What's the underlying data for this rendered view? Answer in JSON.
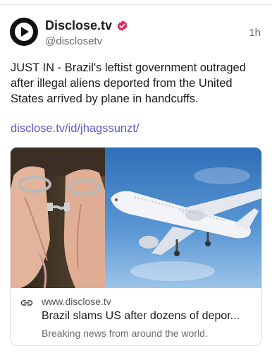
{
  "post": {
    "author_name": "Disclose.tv",
    "author_handle": "@disclosetv",
    "timestamp": "1h",
    "text": "JUST IN - Brazil's leftist government outraged after illegal aliens deported from the United States arrived by plane in handcuffs.",
    "link": "disclose.tv/id/jhagssunzt/",
    "avatar_icon": "play-logo-icon",
    "verified_icon": "verified-badge-icon",
    "verified_color": "#e0245e"
  },
  "card": {
    "domain": "www.disclose.tv",
    "title": "Brazil slams US after dozens of depor...",
    "description": "Breaking news from around the world.",
    "link_icon": "chain-link-icon",
    "image_left": "handcuffed-hands",
    "image_right": "airplane-in-sky"
  },
  "colors": {
    "link": "#5b5bc8",
    "text": "#1c1c1c",
    "muted": "#6b6b6b",
    "sky": "#4a86c8"
  }
}
